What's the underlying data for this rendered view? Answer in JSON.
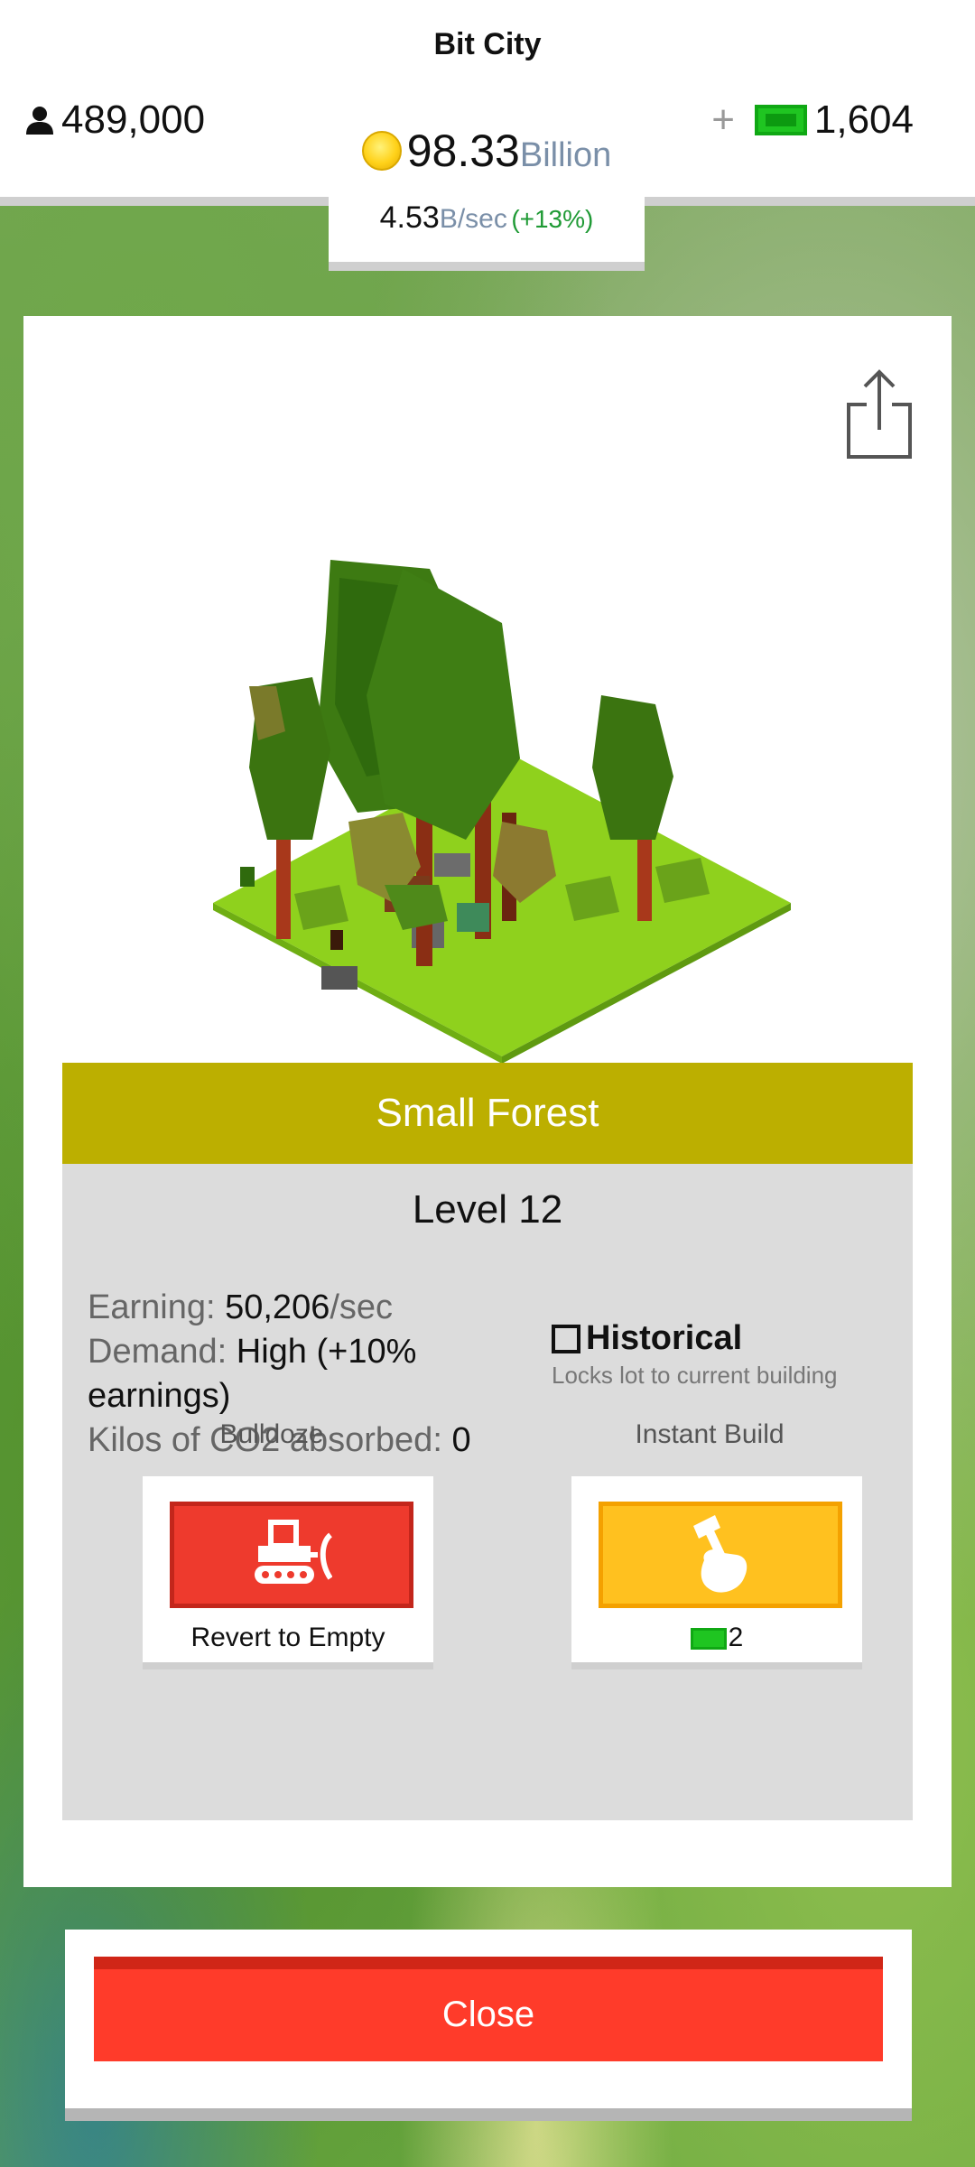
{
  "header": {
    "title": "Bit City",
    "population": "489,000",
    "coins_value": "98.33",
    "coins_unit": "Billion",
    "rate_value": "4.53",
    "rate_unit": "B/sec",
    "rate_pct": "(+13%)",
    "plus": "+",
    "bucks": "1,604"
  },
  "building": {
    "name": "Small Forest",
    "level": "Level 12",
    "earning_label": "Earning:",
    "earning_value": "50,206",
    "earning_unit": "/sec",
    "demand_label": "Demand:",
    "demand_value": "High (+10% earnings)",
    "co2_label": "Kilos of CO2 absorbed:",
    "co2_value": "0",
    "historical_label": "Historical",
    "historical_sub": "Locks lot to current building",
    "historical_checked": false
  },
  "actions": {
    "bulldoze_label": "Bulldoze",
    "bulldoze_caption": "Revert to Empty",
    "instant_label": "Instant Build",
    "instant_cost": "2"
  },
  "footer": {
    "close_label": "Close"
  },
  "icons": {
    "population": "person-icon",
    "coins": "coin-icon",
    "bucks": "cash-icon",
    "share": "share-icon",
    "bulldozer": "bulldozer-icon",
    "build": "hammer-hand-icon"
  },
  "colors": {
    "title_band": "#bcaf00",
    "bulldoze": "#ee3a2d",
    "instant": "#ffc11f",
    "close": "#ff3b2a",
    "cash": "#1fc521"
  }
}
